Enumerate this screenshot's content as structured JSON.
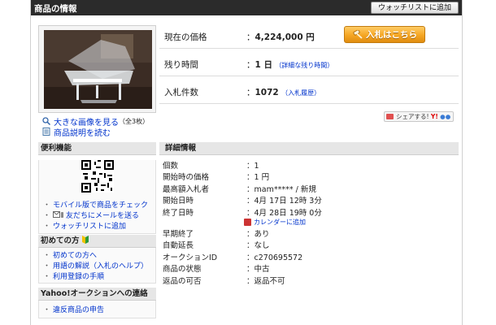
{
  "header": {
    "title": "商品の情報",
    "watchlist_button": "ウォッチリストに追加"
  },
  "image_links": {
    "large_image": "大きな画像を見る",
    "large_image_count": "（全3枚）",
    "description": "商品説明を読む"
  },
  "summary": {
    "price_label": "現在の価格",
    "price_value": "4,224,000 円",
    "bid_button": "入札はこちら",
    "time_label": "残り時間",
    "time_value": "1 日",
    "time_link": "（詳細な残り時間）",
    "bids_label": "入札件数",
    "bids_value": "1072",
    "bids_link": "（入札履歴）"
  },
  "share": {
    "label": "シェアする!"
  },
  "sidebar": {
    "convenience": {
      "title": "便利機能",
      "items": [
        "モバイル版で商品をチェック",
        "友だちにメールを送る",
        "ウォッチリストに追加"
      ]
    },
    "beginners": {
      "title": "初めての方",
      "items": [
        "初めての方へ",
        "用語の解説（入札のヘルプ）",
        "利用登録の手順"
      ]
    },
    "contact": {
      "title": "Yahoo!オークションへの連絡",
      "items": [
        "違反商品の申告"
      ]
    }
  },
  "details": {
    "title": "詳細情報",
    "rows": [
      {
        "key": "個数",
        "value": "1"
      },
      {
        "key": "開始時の価格",
        "value": "1 円"
      },
      {
        "key": "最高額入札者",
        "value": "mam***** / 新規"
      },
      {
        "key": "開始日時",
        "value": "4月 17日 12時 3分"
      },
      {
        "key": "終了日時",
        "value": "4月 28日 19時 0分"
      },
      {
        "key": "",
        "value": "カレンダーに追加"
      },
      {
        "key": "早期終了",
        "value": "あり"
      },
      {
        "key": "自動延長",
        "value": "なし"
      },
      {
        "key": "オークションID",
        "value": "c270695572"
      },
      {
        "key": "商品の状態",
        "value": "中古"
      },
      {
        "key": "返品の可否",
        "value": "返品不可"
      }
    ]
  },
  "colors": {
    "bid_button": "#f5a623",
    "link": "#0033cc",
    "header_bar": "#2b2b2b"
  }
}
